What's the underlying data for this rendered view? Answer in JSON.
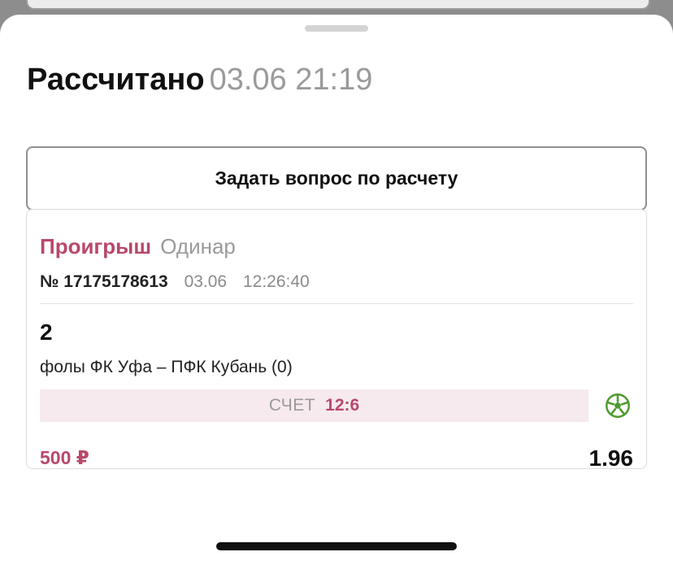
{
  "header": {
    "title": "Рассчитано",
    "date": "03.06 21:19"
  },
  "actions": {
    "ask_label": "Задать вопрос по расчету"
  },
  "bet": {
    "status": "Проигрыш",
    "type": "Одинар",
    "number": "№ 17175178613",
    "date": "03.06",
    "time": "12:26:40",
    "pick": "2",
    "event": "фолы ФК Уфа – ПФК Кубань (0)",
    "score_label": "СЧЕТ",
    "score_value": "12:6",
    "sport_icon": "soccer-ball-icon",
    "stake": "500 ₽",
    "odds": "1.96"
  },
  "colors": {
    "lost": "#b8486a",
    "score_bg": "#f6eaee",
    "sport_icon": "#4e9a2f"
  }
}
